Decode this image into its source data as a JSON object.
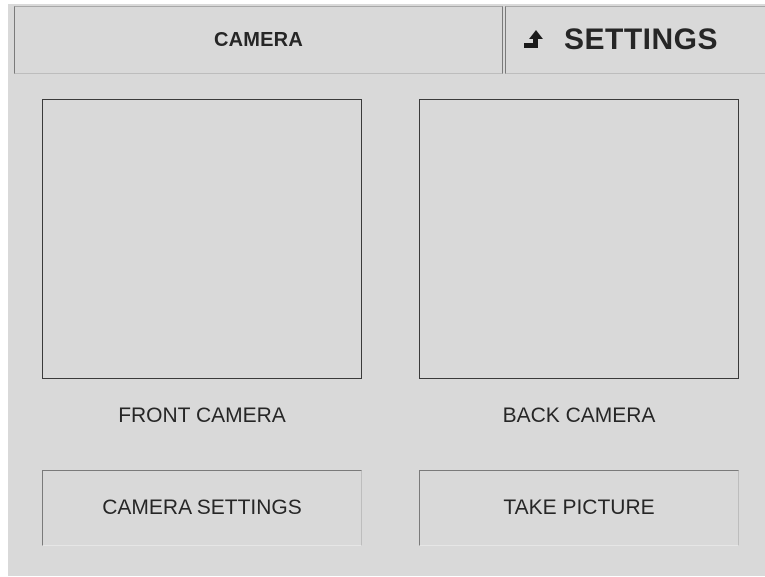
{
  "header": {
    "tab_camera": "CAMERA",
    "tab_settings": "SETTINGS",
    "settings_icon": "return-arrow-icon"
  },
  "cameras": {
    "front_label": "FRONT CAMERA",
    "back_label": "BACK CAMERA"
  },
  "actions": {
    "camera_settings": "CAMERA SETTINGS",
    "take_picture": "TAKE PICTURE"
  },
  "colors": {
    "background": "#d9d9d9",
    "text": "#262626",
    "border": "#3a3a3a"
  }
}
